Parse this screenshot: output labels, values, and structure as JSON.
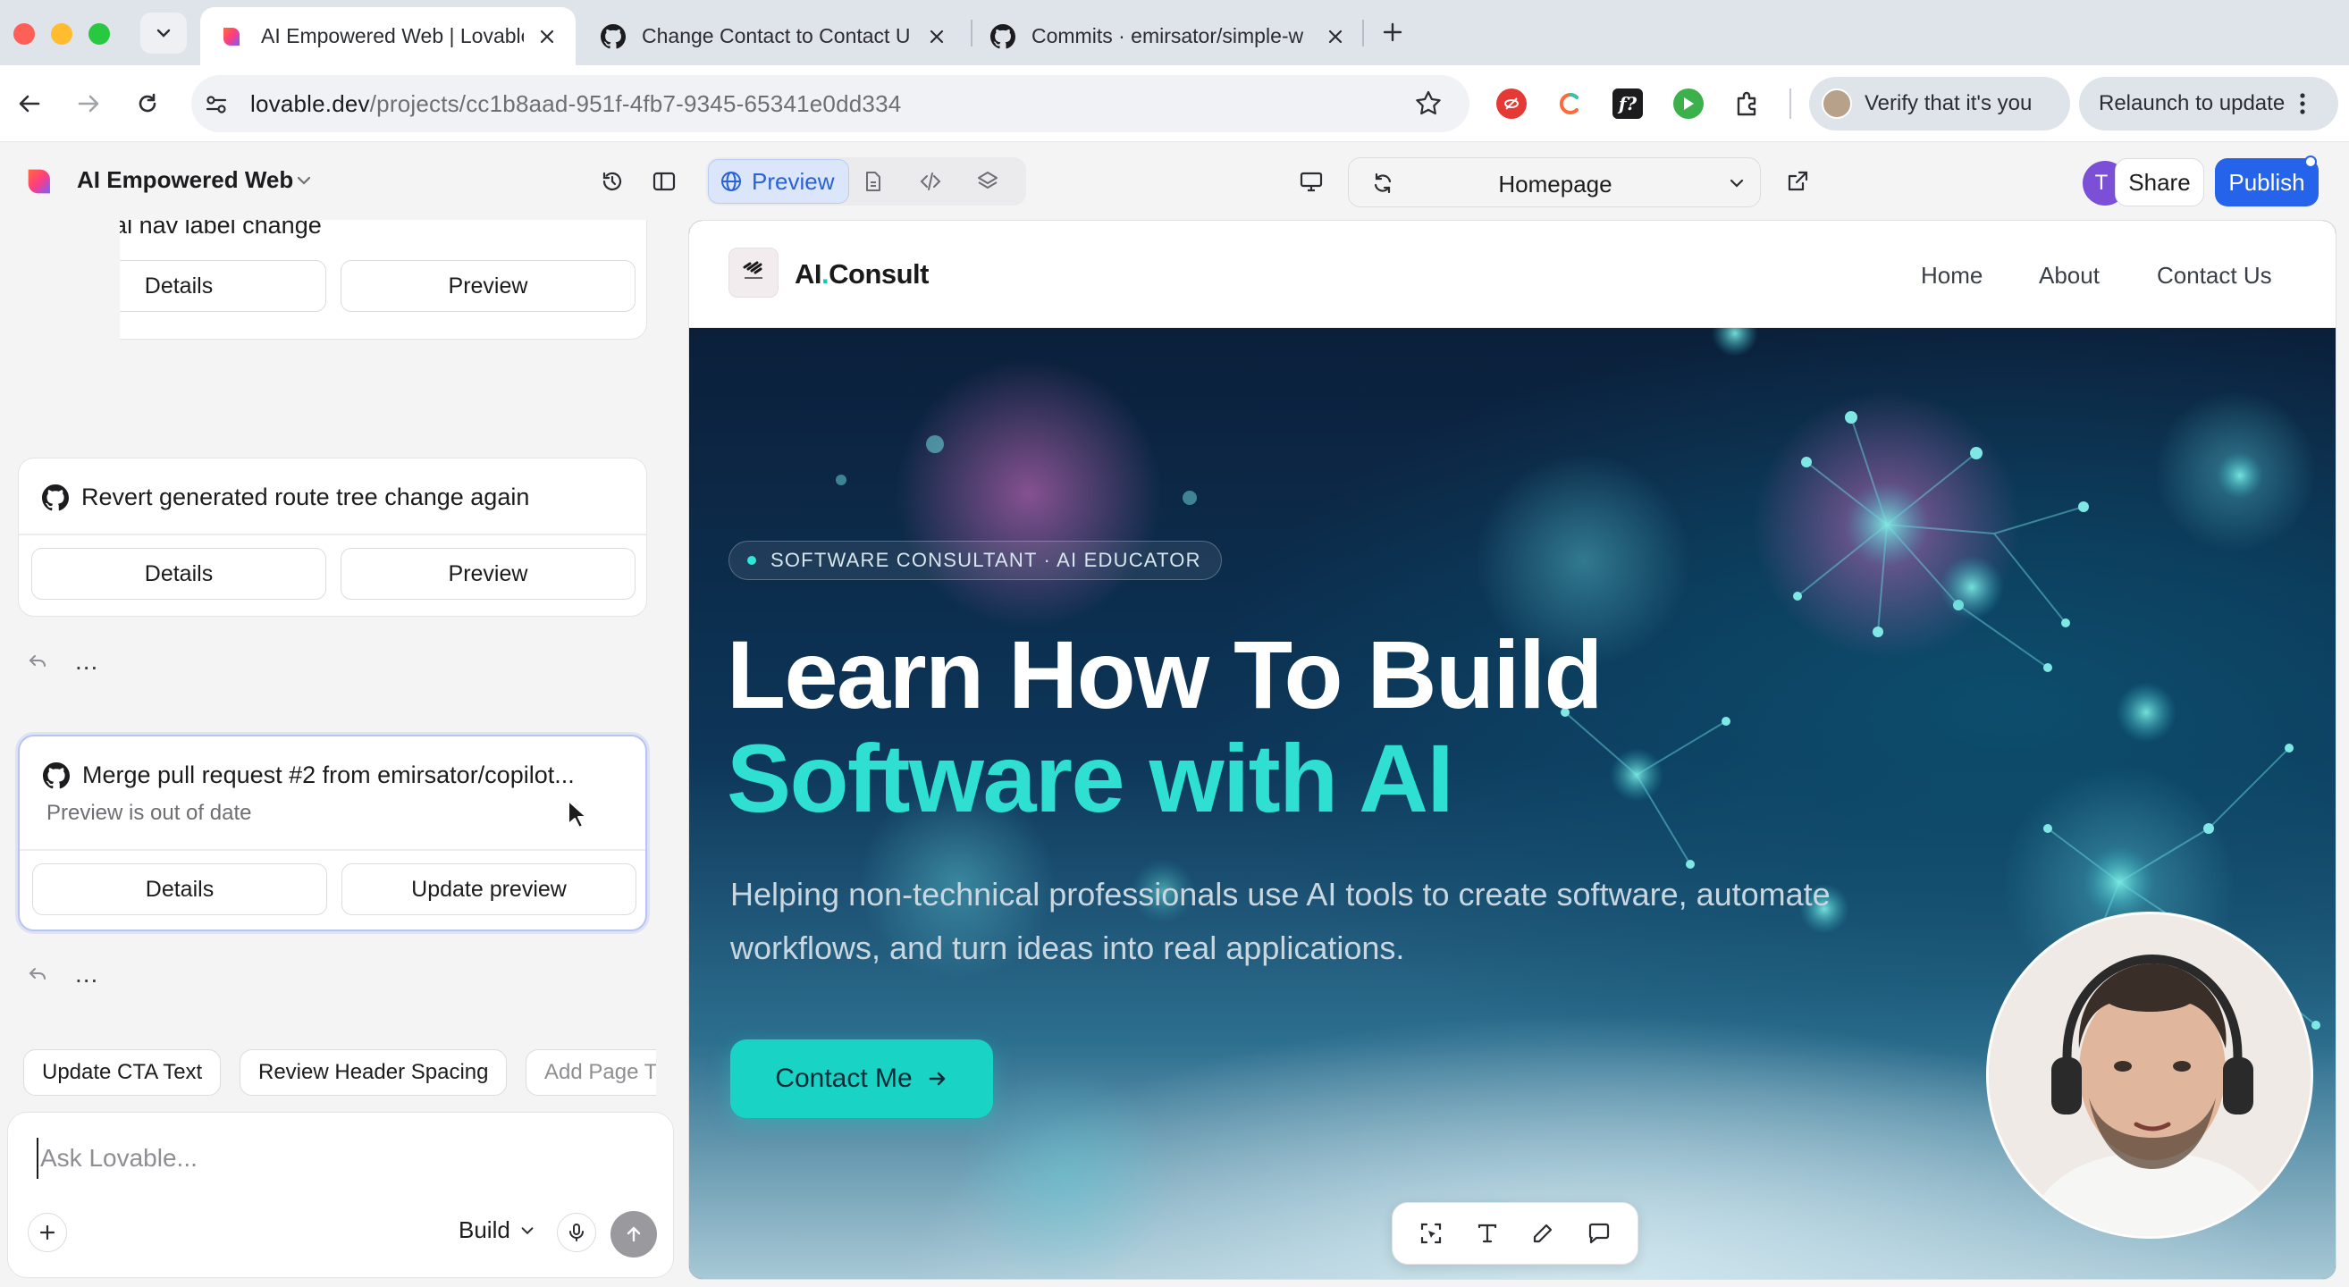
{
  "browser": {
    "tabs": [
      {
        "title": "AI Empowered Web | Lovable",
        "active": true
      },
      {
        "title": "Change Contact to Contact U",
        "active": false
      },
      {
        "title": "Commits · emirsator/simple-w",
        "active": false
      }
    ],
    "url_host": "lovable.dev",
    "url_path": "/projects/cc1b8aad-951f-4fb7-9345-65341e0dd334",
    "verify_label": "Verify that it's you",
    "relaunch_label": "Relaunch to update"
  },
  "app": {
    "project_name": "AI Empowered Web",
    "mode_preview_label": "Preview",
    "page_selector": "Homepage",
    "avatar_initial": "T",
    "share_label": "Share",
    "publish_label": "Publish"
  },
  "chat": {
    "cards": [
      {
        "title": "on final nav label change",
        "details": "Details",
        "action": "Preview"
      },
      {
        "title": "Revert generated route tree change again",
        "details": "Details",
        "action": "Preview"
      },
      {
        "title": "Merge pull request #2 from emirsator/copilot...",
        "subtitle": "Preview is out of date",
        "details": "Details",
        "action": "Update preview"
      }
    ],
    "more_label": "...",
    "suggestions": [
      "Update CTA Text",
      "Review Header Spacing",
      "Add Page T"
    ],
    "composer_placeholder": "Ask Lovable...",
    "build_label": "Build"
  },
  "site": {
    "brand_main": "AI",
    "brand_dot": ".",
    "brand_rest": "Consult",
    "nav": [
      "Home",
      "About",
      "Contact Us"
    ],
    "badge": "SOFTWARE CONSULTANT · AI EDUCATOR",
    "headline_1": "Learn How To Build",
    "headline_2": "Software with AI",
    "paragraph": "Helping non-technical professionals use AI tools to create software, automate workflows, and turn ideas into real applications.",
    "cta": "Contact Me"
  },
  "colors": {
    "accent_blue": "#2563eb",
    "teal": "#2fe0d2",
    "hero_dark": "#0b1f3a"
  }
}
